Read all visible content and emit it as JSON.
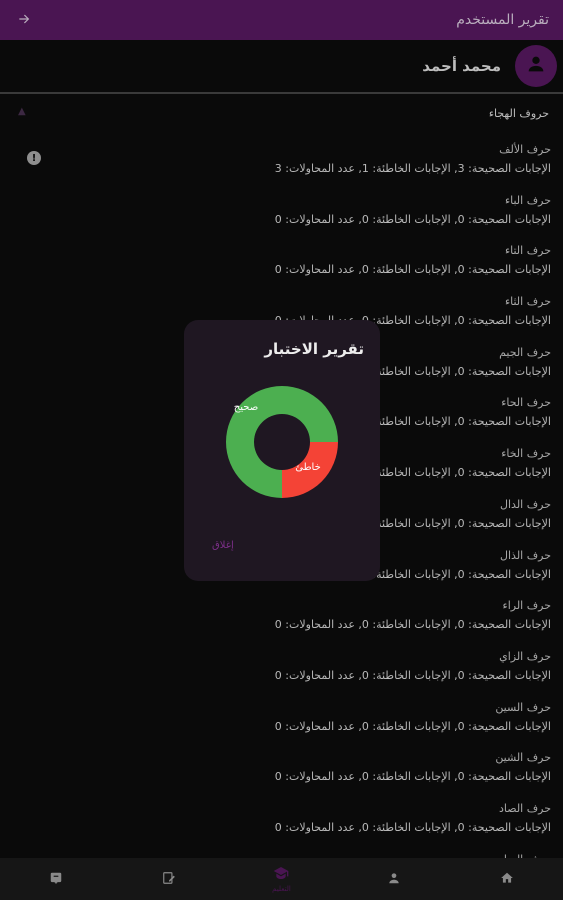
{
  "appbar": {
    "title": "تقرير المستخدم",
    "back_icon": "arrow-right-icon"
  },
  "user": {
    "name": "محمد أحمد",
    "avatar_icon": "person-icon"
  },
  "category": {
    "title": "حروف الهجاء",
    "chevron_icon": "chevron-up-icon",
    "info_icon": "info-icon"
  },
  "letters": [
    {
      "name": "حرف الألف",
      "stats": "الإجابات الصحيحة: 3, الإجابات الخاطئة: 1, عدد المحاولات: 3"
    },
    {
      "name": "حرف الباء",
      "stats": "الإجابات الصحيحة: 0, الإجابات الخاطئة: 0, عدد المحاولات: 0"
    },
    {
      "name": "حرف التاء",
      "stats": "الإجابات الصحيحة: 0, الإجابات الخاطئة: 0, عدد المحاولات: 0"
    },
    {
      "name": "حرف الثاء",
      "stats": "الإجابات الصحيحة: 0, الإجابات الخاطئة: 0, عدد المحاولات: 0"
    },
    {
      "name": "حرف الجيم",
      "stats": "الإجابات الصحيحة: 0, الإجابات الخاطئة: 0, عدد المحاولات: 0"
    },
    {
      "name": "حرف الحاء",
      "stats": "الإجابات الصحيحة: 0, الإجابات الخاطئة: 0, عدد المحاولات: 0"
    },
    {
      "name": "حرف الخاء",
      "stats": "الإجابات الصحيحة: 0, الإجابات الخاطئة: 0, عدد المحاولات: 0"
    },
    {
      "name": "حرف الدال",
      "stats": "الإجابات الصحيحة: 0, الإجابات الخاطئة: 0, عدد المحاولات: 0"
    },
    {
      "name": "حرف الذال",
      "stats": "الإجابات الصحيحة: 0, الإجابات الخاطئة: 0, عدد المحاولات: 0"
    },
    {
      "name": "حرف الراء",
      "stats": "الإجابات الصحيحة: 0, الإجابات الخاطئة: 0, عدد المحاولات: 0"
    },
    {
      "name": "حرف الزاي",
      "stats": "الإجابات الصحيحة: 0, الإجابات الخاطئة: 0, عدد المحاولات: 0"
    },
    {
      "name": "حرف السين",
      "stats": "الإجابات الصحيحة: 0, الإجابات الخاطئة: 0, عدد المحاولات: 0"
    },
    {
      "name": "حرف الشين",
      "stats": "الإجابات الصحيحة: 0, الإجابات الخاطئة: 0, عدد المحاولات: 0"
    },
    {
      "name": "حرف الصاد",
      "stats": "الإجابات الصحيحة: 0, الإجابات الخاطئة: 0, عدد المحاولات: 0"
    },
    {
      "name": "حرف الضاد",
      "stats": ""
    }
  ],
  "dialog": {
    "title": "تقرير الاختبار",
    "close_label": "إغلاق"
  },
  "chart_data": {
    "type": "pie",
    "categories": [
      "صحيح",
      "خاطئ"
    ],
    "values": [
      3,
      1
    ],
    "colors": [
      "#4caf50",
      "#f44336"
    ],
    "donut": true
  },
  "bottom_nav": [
    {
      "icon": "home-icon",
      "label": ""
    },
    {
      "icon": "person-icon",
      "label": ""
    },
    {
      "icon": "school-icon",
      "label": "التعليم",
      "active": true
    },
    {
      "icon": "edit-icon",
      "label": ""
    },
    {
      "icon": "quiz-icon",
      "label": ""
    }
  ],
  "colors": {
    "primary": "#4a1552",
    "background": "#0a0a0a",
    "dialog": "#1f1722",
    "correct": "#4caf50",
    "wrong": "#f44336"
  }
}
